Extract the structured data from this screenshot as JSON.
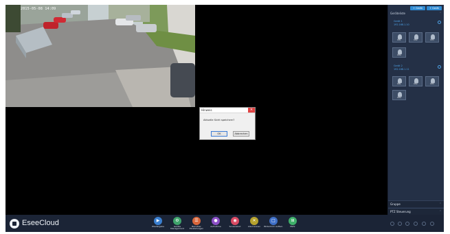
{
  "app": {
    "brand": "EseeCloud",
    "accent": "#2f8bd3"
  },
  "camera": {
    "timestamp": "2015-05-08 14:09"
  },
  "dialog": {
    "title": "Hinweis",
    "message": "Aktuelle Sicht speichern?",
    "ok_label": "OK",
    "cancel_label": "Abbrechen"
  },
  "sidebar": {
    "top_buttons": [
      "+ Gerät",
      "+ Gerät"
    ],
    "device_list_title": "Geräteliste",
    "groups": [
      {
        "name": "Gerät 1",
        "sub": "192.168.1.10",
        "thumbs": [
          "CH1",
          "CH2",
          "CH3",
          "CH4"
        ]
      },
      {
        "name": "Gerät 2",
        "sub": "192.168.1.11",
        "thumbs": [
          "CH1",
          "CH2",
          "CH3",
          "CH4"
        ]
      }
    ],
    "group_label": "Gruppe",
    "ptz_label": "PTZ Steuerung"
  },
  "toolbar": {
    "tools": [
      {
        "icon": "playback-icon",
        "glyph": "▶",
        "color": "#3a7fd0",
        "label": "Wiedergabe"
      },
      {
        "icon": "device-manage-icon",
        "glyph": "⚙",
        "color": "#3fa36b",
        "label": "Geräte Management"
      },
      {
        "icon": "local-settings-icon",
        "glyph": "☰",
        "color": "#d8663b",
        "label": "Benutzer Einstellungen"
      },
      {
        "icon": "record-icon",
        "glyph": "●",
        "color": "#8a4fc5",
        "label": "Aufnahme"
      },
      {
        "icon": "screenshot-icon",
        "glyph": "◉",
        "color": "#d94a63",
        "label": "Screenshot"
      },
      {
        "icon": "close-all-icon",
        "glyph": "✕",
        "color": "#b5a22e",
        "label": "Alle trennen"
      },
      {
        "icon": "fullscreen-icon",
        "glyph": "□",
        "color": "#3e6fc8",
        "label": "Bildschirm Aufteil."
      },
      {
        "icon": "layout-icon",
        "glyph": "⊞",
        "color": "#3faf6a",
        "label": "Mehr"
      }
    ]
  }
}
